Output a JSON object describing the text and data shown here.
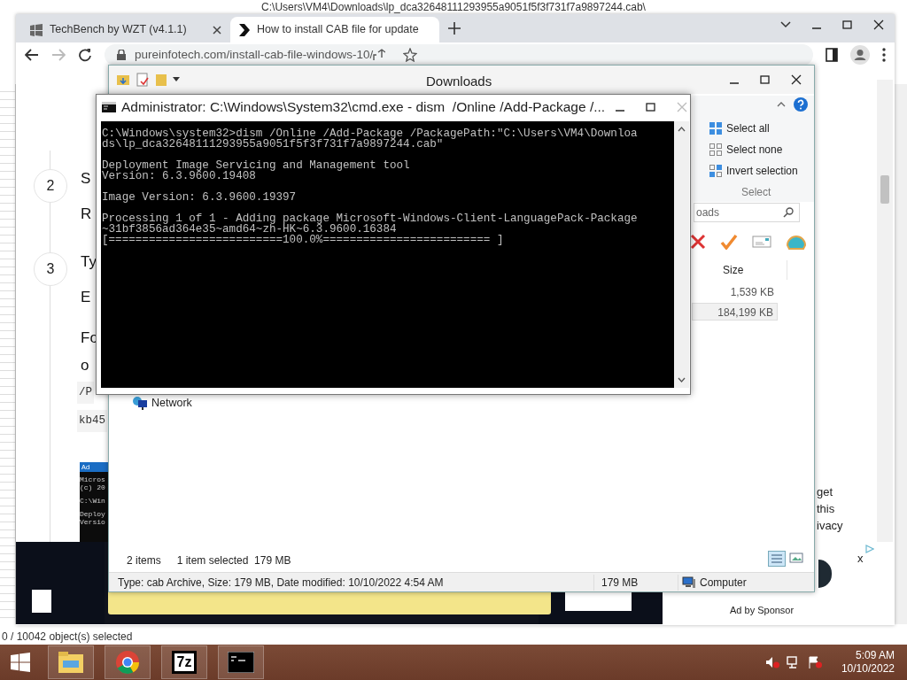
{
  "background_window": {
    "title": "C:\\Users\\VM4\\Downloads\\lp_dca32648111293955a9051f5f3f731f7a9897244.cab\\",
    "status": "0 / 10042 object(s) selected"
  },
  "browser": {
    "tabs": [
      {
        "label": "TechBench by WZT (v4.1.1)",
        "selected": false,
        "kind": "windows"
      },
      {
        "label": "How to install CAB file for update",
        "selected": true,
        "kind": "chevron"
      }
    ],
    "address": "pureinfotech.com/install-cab-file-windows-10/",
    "page": {
      "steps": [
        {
          "number": "2",
          "lines": [
            "S",
            "R"
          ]
        },
        {
          "number": "3",
          "lines": [
            "Ty",
            "E"
          ]
        }
      ],
      "paragraph_lines": [
        "Fo",
        "o"
      ],
      "code_lines": [
        "/P",
        "kb45"
      ],
      "article_screenshot": {
        "title": "Ad",
        "lines": [
          "Micros",
          "(c) 20",
          "C:\\Win",
          "Deploy",
          "Versio"
        ]
      },
      "right_fragments": [
        "get",
        "this",
        "ivacy"
      ],
      "ad": {
        "label": "Ad by Sponsor",
        "close": "x"
      }
    }
  },
  "explorer": {
    "title": "Downloads",
    "select_group": {
      "label": "Select",
      "items": [
        "Select all",
        "Select none",
        "Invert selection"
      ]
    },
    "search": {
      "value": "oads"
    },
    "columns": [
      "Size"
    ],
    "rows": [
      {
        "size": "1,539 KB",
        "selected": false
      },
      {
        "size": "184,199 KB",
        "selected": true
      }
    ],
    "nav": [
      "Network"
    ],
    "status": {
      "count": "2 items",
      "selection": "1 item selected  179 MB"
    },
    "details": {
      "text": "Type: cab Archive, Size: 179 MB, Date modified: 10/10/2022 4:54 AM",
      "size": "179 MB",
      "location": "Computer"
    }
  },
  "console": {
    "title": "Administrator: C:\\Windows\\System32\\cmd.exe - dism  /Online /Add-Package /...",
    "blocks": [
      [
        "C:\\Windows\\system32>dism /Online /Add-Package /PackagePath:\"C:\\Users\\VM4\\Downloa",
        "ds\\lp_dca32648111293955a9051f5f3f731f7a9897244.cab\""
      ],
      [
        "Deployment Image Servicing and Management tool",
        "Version: 6.3.9600.19408"
      ],
      [
        "Image Version: 6.3.9600.19397"
      ],
      [
        "Processing 1 of 1 - Adding package Microsoft-Windows-Client-LanguagePack-Package",
        "~31bf3856ad364e35~amd64~zh-HK~6.3.9600.16384",
        "[==========================100.0%========================= ]"
      ]
    ]
  },
  "taskbar": {
    "apps": [
      {
        "kind": "explorer"
      },
      {
        "kind": "chrome"
      },
      {
        "kind": "sevenzip",
        "label": "7z"
      },
      {
        "kind": "console"
      }
    ],
    "time": "5:09 AM",
    "date": "10/10/2022"
  }
}
